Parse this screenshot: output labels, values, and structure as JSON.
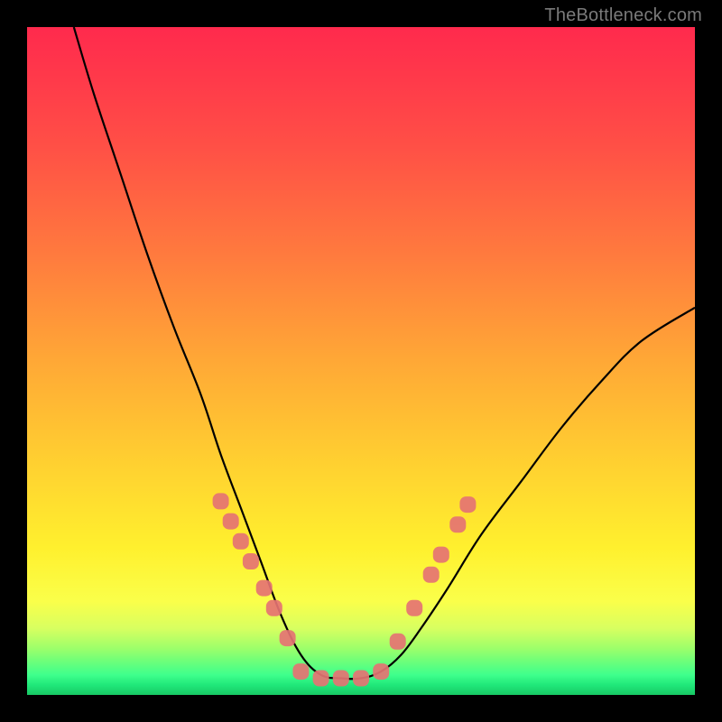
{
  "watermark": "TheBottleneck.com",
  "colors": {
    "frame": "#000000",
    "curve": "#000000",
    "marker": "#e57373",
    "gradient_stops": [
      "#ff2a4d",
      "#ff7a3e",
      "#ffd230",
      "#fff02e",
      "#20e87a"
    ]
  },
  "chart_data": {
    "type": "line",
    "title": "",
    "xlabel": "",
    "ylabel": "",
    "xlim": [
      0,
      100
    ],
    "ylim": [
      0,
      100
    ],
    "grid": false,
    "legend": false,
    "series": [
      {
        "name": "bottleneck-curve",
        "description": "Asymmetric V-shaped curve. Left branch falls steeply from (7,100) down to a flat trough near y≈2.5 over roughly x≈40-52, right branch rises with shallower slope toward (100,58).",
        "x": [
          7,
          10,
          14,
          18,
          22,
          26,
          29,
          32,
          35,
          38,
          41,
          44,
          47,
          50,
          53,
          56,
          59,
          63,
          68,
          74,
          80,
          86,
          92,
          100
        ],
        "values": [
          100,
          90,
          78,
          66,
          55,
          45,
          36,
          28,
          20,
          12,
          6,
          3,
          2.5,
          2.5,
          3.5,
          6,
          10,
          16,
          24,
          32,
          40,
          47,
          53,
          58
        ]
      }
    ],
    "markers": {
      "name": "highlighted-points",
      "description": "Salmon rounded markers placed along both branches of the curve below roughly y=29, plus a few forming the flat trough.",
      "points": [
        {
          "x": 29.0,
          "y": 29.0
        },
        {
          "x": 30.5,
          "y": 26.0
        },
        {
          "x": 32.0,
          "y": 23.0
        },
        {
          "x": 33.5,
          "y": 20.0
        },
        {
          "x": 35.5,
          "y": 16.0
        },
        {
          "x": 37.0,
          "y": 13.0
        },
        {
          "x": 39.0,
          "y": 8.5
        },
        {
          "x": 41.0,
          "y": 3.5
        },
        {
          "x": 44.0,
          "y": 2.5
        },
        {
          "x": 47.0,
          "y": 2.5
        },
        {
          "x": 50.0,
          "y": 2.5
        },
        {
          "x": 53.0,
          "y": 3.5
        },
        {
          "x": 55.5,
          "y": 8.0
        },
        {
          "x": 58.0,
          "y": 13.0
        },
        {
          "x": 60.5,
          "y": 18.0
        },
        {
          "x": 62.0,
          "y": 21.0
        },
        {
          "x": 64.5,
          "y": 25.5
        },
        {
          "x": 66.0,
          "y": 28.5
        }
      ]
    }
  }
}
